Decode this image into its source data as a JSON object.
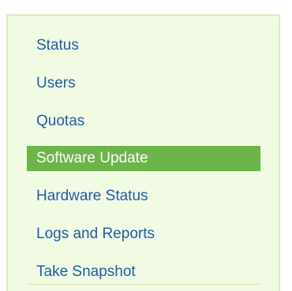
{
  "nav": {
    "items": [
      {
        "label": "Status",
        "active": false
      },
      {
        "label": "Users",
        "active": false
      },
      {
        "label": "Quotas",
        "active": false
      },
      {
        "label": "Software Update",
        "active": true
      },
      {
        "label": "Hardware Status",
        "active": false
      },
      {
        "label": "Logs and Reports",
        "active": false
      },
      {
        "label": "Take Snapshot",
        "active": false
      }
    ]
  },
  "colors": {
    "panel_background": "#f1fbe4",
    "panel_border": "#d8ecc2",
    "link": "#1d5fa8",
    "active_background": "#6db54a",
    "active_text": "#ffffff"
  }
}
